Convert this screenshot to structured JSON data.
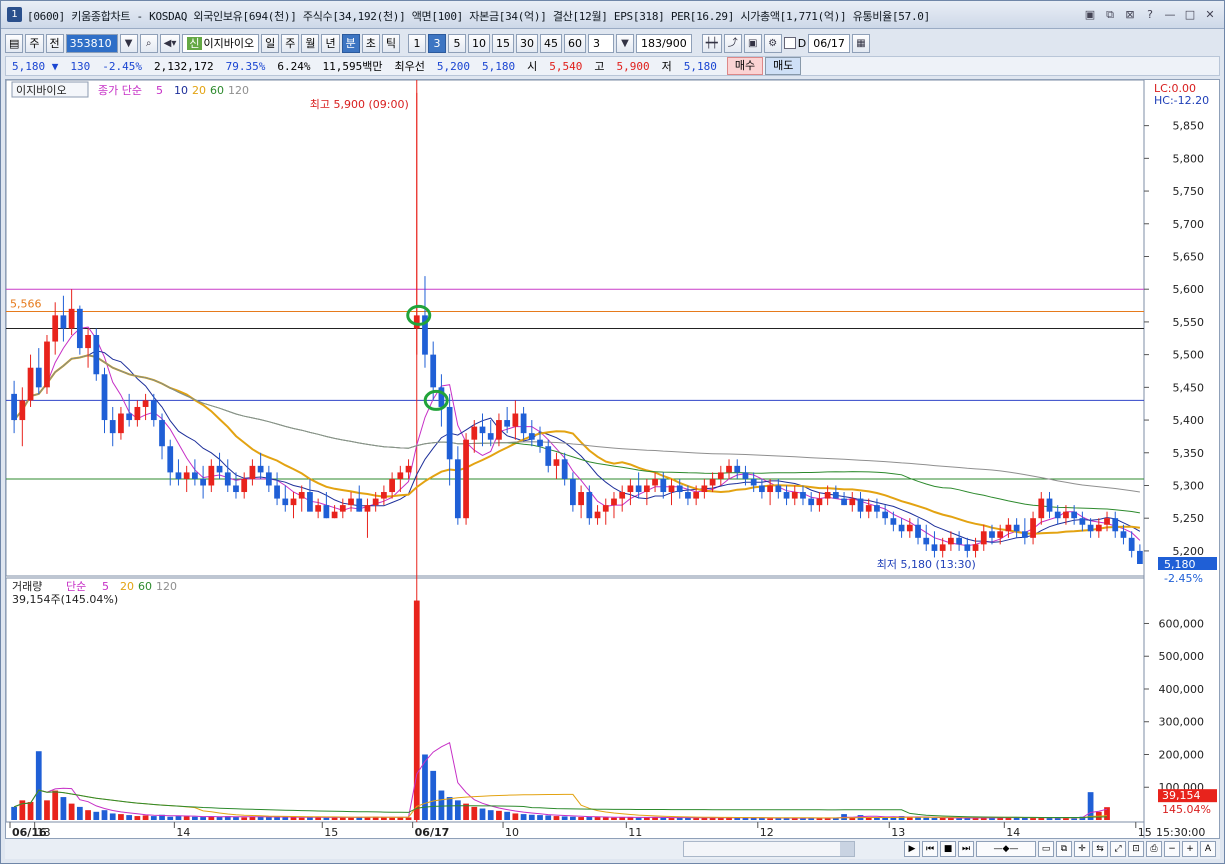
{
  "window": {
    "number": "1",
    "title": "[0600] 키움종합차트 - KOSDAQ 외국인보유[694(천)] 주식수[34,192(천)] 액면[100] 자본금[34(억)] 결산[12월] EPS[318] PER[16.29] 시가총액[1,771(억)] 유통비율[57.0]",
    "buttons": [
      "▣",
      "⧉",
      "⊠",
      "?",
      "—",
      "□",
      "✕"
    ]
  },
  "toolbar": {
    "mode1": "주",
    "mode2": "전",
    "code": "353810",
    "new_tag": "신",
    "stock_name": "이지바이오",
    "periods": [
      "일",
      "주",
      "월",
      "년",
      "분",
      "초",
      "틱"
    ],
    "selected_period": "분",
    "intervals": [
      "1",
      "3",
      "5",
      "10",
      "15",
      "30",
      "45",
      "60"
    ],
    "selected_interval": "3",
    "interval_value": "3",
    "count": "183",
    "count_max": "/900",
    "d_label": "D",
    "date": "06/17"
  },
  "quote": {
    "price": "5,180 ▼",
    "change": "130",
    "change_pct": "-2.45%",
    "volume": "2,132,172",
    "vol_ratio": "79.35%",
    "turnover": "6.24%",
    "amount": "11,595백만",
    "best_label": "최우선",
    "bid": "5,200",
    "ask": "5,180",
    "open_label": "시",
    "open": "5,540",
    "high_label": "고",
    "high": "5,900",
    "low_label": "저",
    "low": "5,180",
    "buy": "매수",
    "sell": "매도"
  },
  "price_panel": {
    "title": "이지바이오",
    "ma_title": "종가 단순",
    "ma_periods": [
      "5",
      "10",
      "20",
      "60",
      "120"
    ],
    "lc_label": "LC:0.00",
    "hc_label": "HC:-12.20",
    "high_annot": "최고 5,900 (09:00)",
    "low_annot": "최저 5,180 (13:30)",
    "left_level": "5,566",
    "last_price": "5,180",
    "last_pct": "-2.45%",
    "y_ticks": [
      "5,850",
      "5,800",
      "5,750",
      "5,700",
      "5,650",
      "5,600",
      "5,550",
      "5,500",
      "5,450",
      "5,400",
      "5,350",
      "5,300",
      "5,250",
      "5,200"
    ]
  },
  "volume_panel": {
    "title": "거래량",
    "ma_title": "단순",
    "ma_periods": [
      "5",
      "20",
      "60",
      "120"
    ],
    "current": "39,154주(145.04%)",
    "last_volume": "39,154",
    "last_pct": "145.04%",
    "y_ticks": [
      "600,000",
      "500,000",
      "400,000",
      "300,000",
      "200,000",
      "100,000"
    ]
  },
  "x_axis": {
    "labels": [
      "06/16",
      "13",
      "14",
      "15",
      "06/17",
      "10",
      "11",
      "12",
      "13",
      "14",
      "15"
    ],
    "time": "15:30:00"
  },
  "colors": {
    "up": "#e8231c",
    "down": "#1f5fd6",
    "ma5": "#c62fc6",
    "ma10": "#1d2f9a",
    "ma20": "#e3a312",
    "ma60": "#2d8a2d",
    "ma120": "#8f8f8f",
    "marker": "#21a33a"
  },
  "chart_data": {
    "type": "candlestick",
    "interval": "3min",
    "ohlc": [
      [
        5440,
        5460,
        5380,
        5400
      ],
      [
        5400,
        5450,
        5360,
        5430
      ],
      [
        5430,
        5500,
        5420,
        5480
      ],
      [
        5480,
        5510,
        5440,
        5450
      ],
      [
        5450,
        5530,
        5440,
        5520
      ],
      [
        5520,
        5580,
        5500,
        5560
      ],
      [
        5560,
        5590,
        5520,
        5540
      ],
      [
        5540,
        5600,
        5530,
        5570
      ],
      [
        5570,
        5575,
        5500,
        5510
      ],
      [
        5510,
        5540,
        5480,
        5530
      ],
      [
        5530,
        5540,
        5460,
        5470
      ],
      [
        5470,
        5480,
        5380,
        5400
      ],
      [
        5400,
        5420,
        5360,
        5380
      ],
      [
        5380,
        5420,
        5370,
        5410
      ],
      [
        5410,
        5440,
        5390,
        5400
      ],
      [
        5400,
        5430,
        5390,
        5420
      ],
      [
        5420,
        5440,
        5400,
        5430
      ],
      [
        5430,
        5440,
        5390,
        5400
      ],
      [
        5400,
        5410,
        5340,
        5360
      ],
      [
        5360,
        5370,
        5300,
        5320
      ],
      [
        5320,
        5340,
        5300,
        5310
      ],
      [
        5310,
        5330,
        5290,
        5320
      ],
      [
        5320,
        5340,
        5300,
        5310
      ],
      [
        5310,
        5330,
        5280,
        5300
      ],
      [
        5300,
        5340,
        5290,
        5330
      ],
      [
        5330,
        5350,
        5310,
        5320
      ],
      [
        5320,
        5340,
        5290,
        5300
      ],
      [
        5300,
        5320,
        5280,
        5290
      ],
      [
        5290,
        5320,
        5280,
        5310
      ],
      [
        5310,
        5340,
        5300,
        5330
      ],
      [
        5330,
        5350,
        5310,
        5320
      ],
      [
        5320,
        5330,
        5290,
        5300
      ],
      [
        5300,
        5320,
        5270,
        5280
      ],
      [
        5280,
        5300,
        5260,
        5270
      ],
      [
        5270,
        5290,
        5250,
        5280
      ],
      [
        5280,
        5300,
        5260,
        5290
      ],
      [
        5290,
        5310,
        5270,
        5260
      ],
      [
        5260,
        5280,
        5250,
        5270
      ],
      [
        5270,
        5290,
        5250,
        5250
      ],
      [
        5250,
        5270,
        5250,
        5260
      ],
      [
        5260,
        5280,
        5250,
        5270
      ],
      [
        5270,
        5290,
        5260,
        5280
      ],
      [
        5280,
        5300,
        5260,
        5260
      ],
      [
        5260,
        5280,
        5220,
        5270
      ],
      [
        5270,
        5290,
        5260,
        5280
      ],
      [
        5280,
        5300,
        5270,
        5290
      ],
      [
        5290,
        5320,
        5280,
        5310
      ],
      [
        5310,
        5330,
        5290,
        5320
      ],
      [
        5320,
        5340,
        5310,
        5330
      ],
      [
        5540,
        5900,
        5500,
        5560
      ],
      [
        5560,
        5620,
        5480,
        5500
      ],
      [
        5500,
        5520,
        5430,
        5450
      ],
      [
        5450,
        5470,
        5390,
        5420
      ],
      [
        5420,
        5440,
        5300,
        5340
      ],
      [
        5340,
        5360,
        5240,
        5250
      ],
      [
        5250,
        5380,
        5240,
        5370
      ],
      [
        5370,
        5400,
        5350,
        5390
      ],
      [
        5390,
        5410,
        5360,
        5380
      ],
      [
        5380,
        5400,
        5360,
        5370
      ],
      [
        5370,
        5410,
        5360,
        5400
      ],
      [
        5400,
        5420,
        5380,
        5390
      ],
      [
        5390,
        5430,
        5370,
        5410
      ],
      [
        5410,
        5420,
        5370,
        5380
      ],
      [
        5380,
        5400,
        5360,
        5370
      ],
      [
        5370,
        5390,
        5350,
        5360
      ],
      [
        5360,
        5370,
        5320,
        5330
      ],
      [
        5330,
        5350,
        5310,
        5340
      ],
      [
        5340,
        5350,
        5300,
        5310
      ],
      [
        5310,
        5320,
        5260,
        5270
      ],
      [
        5270,
        5300,
        5250,
        5290
      ],
      [
        5290,
        5300,
        5240,
        5250
      ],
      [
        5250,
        5270,
        5240,
        5260
      ],
      [
        5260,
        5280,
        5240,
        5270
      ],
      [
        5270,
        5290,
        5250,
        5280
      ],
      [
        5280,
        5300,
        5260,
        5290
      ],
      [
        5290,
        5310,
        5270,
        5300
      ],
      [
        5300,
        5320,
        5280,
        5290
      ],
      [
        5290,
        5310,
        5270,
        5300
      ],
      [
        5300,
        5320,
        5290,
        5310
      ],
      [
        5310,
        5320,
        5280,
        5290
      ],
      [
        5290,
        5310,
        5270,
        5300
      ],
      [
        5300,
        5310,
        5280,
        5290
      ],
      [
        5290,
        5300,
        5270,
        5280
      ],
      [
        5280,
        5300,
        5270,
        5290
      ],
      [
        5290,
        5310,
        5280,
        5300
      ],
      [
        5300,
        5320,
        5290,
        5310
      ],
      [
        5310,
        5330,
        5300,
        5320
      ],
      [
        5320,
        5340,
        5310,
        5330
      ],
      [
        5330,
        5340,
        5310,
        5320
      ],
      [
        5320,
        5330,
        5300,
        5310
      ],
      [
        5310,
        5320,
        5290,
        5300
      ],
      [
        5300,
        5310,
        5280,
        5290
      ],
      [
        5290,
        5310,
        5270,
        5300
      ],
      [
        5300,
        5310,
        5280,
        5290
      ],
      [
        5290,
        5300,
        5270,
        5280
      ],
      [
        5280,
        5300,
        5270,
        5290
      ],
      [
        5290,
        5300,
        5270,
        5280
      ],
      [
        5280,
        5290,
        5260,
        5270
      ],
      [
        5270,
        5290,
        5260,
        5280
      ],
      [
        5280,
        5300,
        5270,
        5290
      ],
      [
        5290,
        5300,
        5280,
        5280
      ],
      [
        5280,
        5290,
        5270,
        5270
      ],
      [
        5270,
        5290,
        5260,
        5280
      ],
      [
        5280,
        5290,
        5250,
        5260
      ],
      [
        5260,
        5280,
        5250,
        5270
      ],
      [
        5270,
        5280,
        5250,
        5260
      ],
      [
        5260,
        5270,
        5240,
        5250
      ],
      [
        5250,
        5260,
        5230,
        5240
      ],
      [
        5240,
        5250,
        5220,
        5230
      ],
      [
        5230,
        5250,
        5220,
        5240
      ],
      [
        5240,
        5250,
        5210,
        5220
      ],
      [
        5220,
        5240,
        5200,
        5210
      ],
      [
        5210,
        5230,
        5190,
        5200
      ],
      [
        5200,
        5220,
        5190,
        5210
      ],
      [
        5210,
        5230,
        5200,
        5220
      ],
      [
        5220,
        5230,
        5200,
        5210
      ],
      [
        5210,
        5220,
        5190,
        5200
      ],
      [
        5200,
        5220,
        5190,
        5210
      ],
      [
        5210,
        5240,
        5200,
        5230
      ],
      [
        5230,
        5240,
        5210,
        5220
      ],
      [
        5220,
        5240,
        5210,
        5230
      ],
      [
        5230,
        5250,
        5220,
        5240
      ],
      [
        5240,
        5250,
        5220,
        5230
      ],
      [
        5230,
        5250,
        5210,
        5220
      ],
      [
        5220,
        5260,
        5210,
        5250
      ],
      [
        5250,
        5290,
        5240,
        5280
      ],
      [
        5280,
        5290,
        5250,
        5260
      ],
      [
        5260,
        5270,
        5240,
        5250
      ],
      [
        5250,
        5270,
        5240,
        5260
      ],
      [
        5260,
        5270,
        5240,
        5250
      ],
      [
        5250,
        5260,
        5230,
        5240
      ],
      [
        5240,
        5250,
        5220,
        5230
      ],
      [
        5230,
        5250,
        5220,
        5240
      ],
      [
        5240,
        5260,
        5230,
        5250
      ],
      [
        5250,
        5260,
        5220,
        5230
      ],
      [
        5230,
        5240,
        5210,
        5220
      ],
      [
        5220,
        5230,
        5190,
        5200
      ],
      [
        5200,
        5210,
        5180,
        5180
      ]
    ],
    "volume": [
      40000,
      60000,
      55000,
      210000,
      60000,
      90000,
      70000,
      50000,
      40000,
      30000,
      25000,
      30000,
      20000,
      18000,
      15000,
      12000,
      14000,
      12000,
      16000,
      10000,
      12000,
      11000,
      10000,
      9000,
      11000,
      10000,
      12000,
      9000,
      8000,
      10000,
      11000,
      9000,
      8000,
      9000,
      8000,
      7000,
      9000,
      8000,
      7000,
      9000,
      8000,
      7000,
      9000,
      8000,
      10000,
      8000,
      7000,
      9000,
      8000,
      670000,
      200000,
      150000,
      90000,
      70000,
      60000,
      50000,
      40000,
      35000,
      30000,
      28000,
      25000,
      20000,
      18000,
      16000,
      15000,
      14000,
      12000,
      11000,
      10000,
      9000,
      10000,
      9000,
      8000,
      7000,
      9000,
      8000,
      7000,
      9000,
      8000,
      7000,
      6000,
      8000,
      7000,
      6000,
      8000,
      7000,
      6000,
      7000,
      8000,
      6000,
      7000,
      6000,
      5000,
      7000,
      6000,
      5000,
      6000,
      7000,
      6000,
      5000,
      6000,
      18000,
      8000,
      15000,
      9000,
      7000,
      8000,
      10000,
      12000,
      9000,
      8000,
      7000,
      6000,
      7000,
      6000,
      5000,
      6000,
      7000,
      8000,
      6000,
      7000,
      8000,
      9000,
      7000,
      6000,
      7000,
      8000,
      6000,
      9000,
      5000,
      10000,
      85000,
      25000,
      39154
    ],
    "horizontal_levels": [
      5600,
      5566,
      5540,
      5430,
      5310
    ],
    "y_range": [
      5180,
      5880
    ],
    "volume_range": [
      0,
      690000
    ]
  }
}
